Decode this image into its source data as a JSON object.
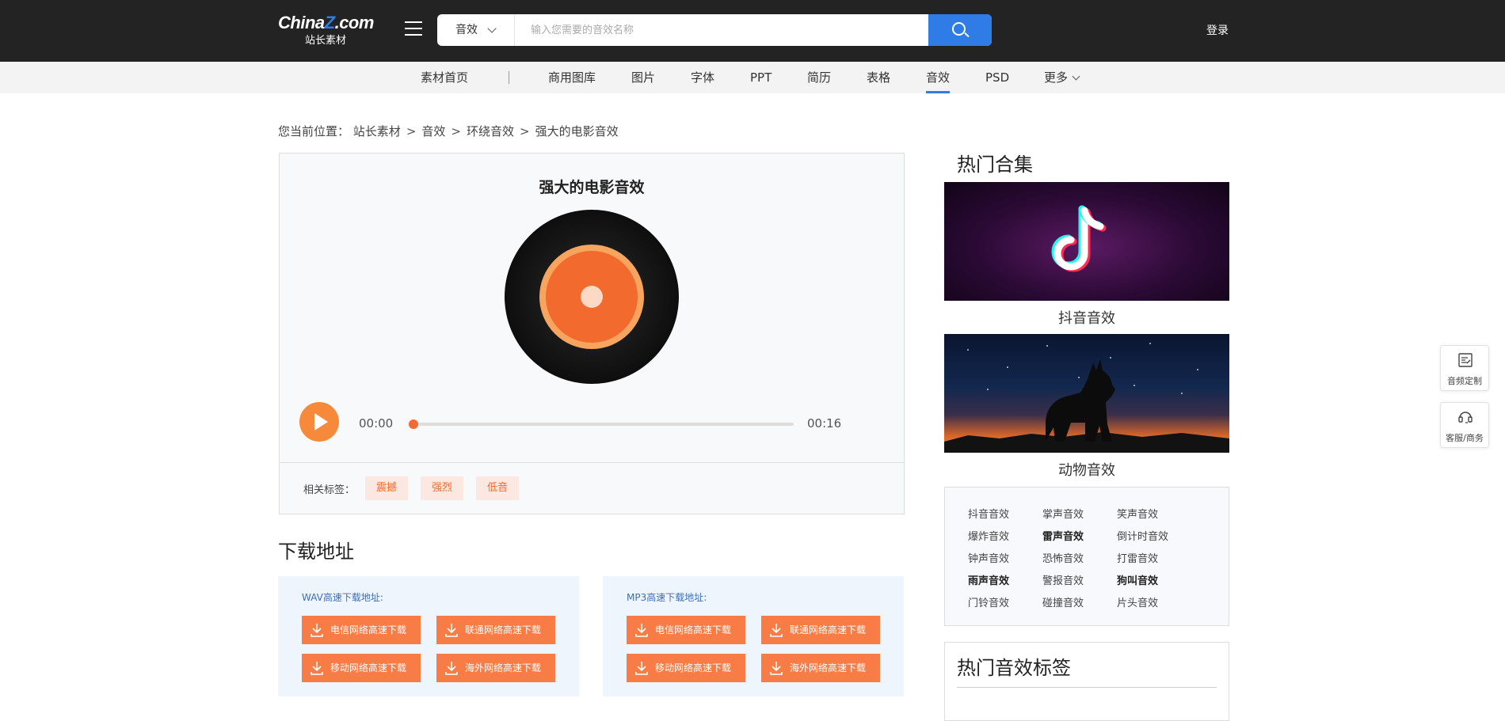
{
  "header": {
    "logo_main": "China",
    "logo_z": "Z",
    "logo_tld": ".com",
    "logo_sub": "站长素材",
    "search_category": "音效",
    "search_placeholder": "输入您需要的音效名称",
    "login_label": "登录",
    "icons": {
      "menu": "hamburger-icon",
      "search": "search-icon",
      "category_chevron": "chevron-down-icon"
    }
  },
  "nav": {
    "items": [
      "素材首页",
      "商用图库",
      "图片",
      "字体",
      "PPT",
      "简历",
      "表格",
      "音效",
      "PSD",
      "更多"
    ],
    "active": "音效"
  },
  "breadcrumb": {
    "prefix": "您当前位置：",
    "items": [
      "站长素材",
      "音效",
      "环绕音效",
      "强大的电影音效"
    ],
    "separator": ">"
  },
  "player": {
    "title": "强大的电影音效",
    "current_time": "00:00",
    "duration": "00:16",
    "progress_fraction": 0.0,
    "tags_label": "相关标签：",
    "tags": [
      "震撼",
      "强烈",
      "低音"
    ]
  },
  "download": {
    "title": "下载地址",
    "boxes": [
      {
        "title": "WAV高速下载地址:",
        "buttons": [
          "电信网络高速下载",
          "联通网络高速下载",
          "移动网络高速下载",
          "海外网络高速下载"
        ]
      },
      {
        "title": "MP3高速下载地址:",
        "buttons": [
          "电信网络高速下载",
          "联通网络高速下载",
          "移动网络高速下载",
          "海外网络高速下载"
        ]
      }
    ]
  },
  "sidebar": {
    "title": "热门合集",
    "collections": [
      "抖音音效",
      "动物音效"
    ],
    "keywords": [
      [
        "抖音音效",
        "掌声音效",
        "笑声音效"
      ],
      [
        "爆炸音效",
        "雷声音效",
        "倒计时音效"
      ],
      [
        "钟声音效",
        "恐怖音效",
        "打雷音效"
      ],
      [
        "雨声音效",
        "警报音效",
        "狗叫音效"
      ],
      [
        "门铃音效",
        "碰撞音效",
        "片头音效"
      ]
    ],
    "bold_keywords": [
      "雷声音效",
      "雨声音效",
      "狗叫音效"
    ],
    "hot_tags_title": "热门音效标签"
  },
  "floating": {
    "custom_label": "音频定制",
    "service_label": "客服/商务"
  },
  "colors": {
    "topbar": "#232323",
    "accent_blue": "#2f7ce6",
    "accent_orange": "#f26a2e",
    "download_button": "#f77c46"
  }
}
